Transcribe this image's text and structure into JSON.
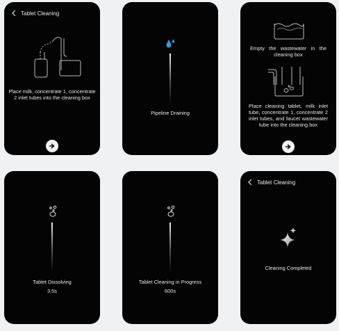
{
  "screens": {
    "tablet_cleaning_1": {
      "title": "Tablet Cleaning",
      "message": "Place milk, concentrate 1, concentrate 2 inlet tubes into the cleaning box"
    },
    "pipeline_draining": {
      "status": "Pipeline Draining"
    },
    "empty_and_place": {
      "message_1": "Empty the wastewater in the cleaning box",
      "message_2": "Place cleaning tablet, milk inlet tube, concentrate 1, concentrate 2 inlet tubes, and faucet wastewater tube into the cleaning box"
    },
    "tablet_dissolving": {
      "status": "Tablet Dissolving",
      "time": "3.5s"
    },
    "cleaning_progress": {
      "status": "Tablet Cleaning in Progress",
      "time": "600s"
    },
    "cleaning_completed": {
      "title": "Tablet Cleaning",
      "status": "Cleaning Completed"
    }
  },
  "icons": {
    "back": "chevron-left-icon",
    "next": "arrow-right-icon",
    "water_drop": "water-drop-icon",
    "tablet": "tablet-bubbles-icon",
    "sparkle": "sparkle-icon"
  },
  "colors": {
    "background": "#f0f1f2",
    "screen": "#040404",
    "text": "#e6e6e6",
    "water_drop": "#2f9be0",
    "button": "#f2f2f2"
  }
}
